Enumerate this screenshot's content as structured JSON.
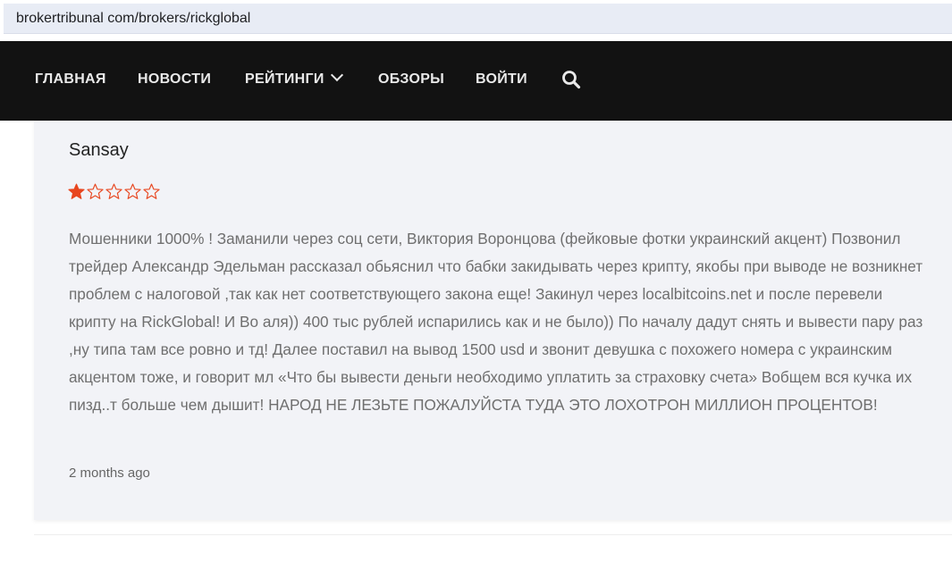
{
  "browser": {
    "url": "brokertribunal com/brokers/rickglobal"
  },
  "nav": {
    "items": [
      "ГЛАВНАЯ",
      "НОВОСТИ",
      "РЕЙТИНГИ",
      "ОБЗОРЫ",
      "ВОЙТИ"
    ],
    "dropdown_icon": "chevron-down-icon",
    "search_icon": "search-icon"
  },
  "review": {
    "author": "Sansay",
    "rating": 1,
    "rating_max": 5,
    "star_color": "#e8461f",
    "text": "Мошенники 1000% ! Заманили через соц сети, Виктория Воронцова (фейковые фотки украинский акцент) Позвонил трейдер Александр Эдельман рассказал обьяснил что бабки закидывать через крипту, якобы при выводе не возникнет проблем с налоговой ,так как нет соответствующего закона еще! Закинул через localbitcoins.net и после перевели крипту на RickGlobal! И Во аля)) 400 тыс рублей испарились как и не было)) По началу дадут снять и вывести пару раз ,ну типа там все ровно и тд! Далее поставил на вывод 1500 usd и звонит девушка с похожего номера с украинским акцентом тоже, и говорит мл «Что бы вывести деньги необходимо уплатить за страховку счета» Вобщем вся кучка их пизд..т больше чем дышит! НАРОД НЕ ЛЕЗЬТЕ ПОЖАЛУЙСТА ТУДА ЭТО ЛОХОТРОН МИЛЛИОН ПРОЦЕНТОВ!",
    "date": "2 months ago"
  },
  "colors": {
    "navbar_bg": "#121212",
    "card_bg": "#f2f3f7",
    "url_bar_bg": "#e8ecf5"
  }
}
